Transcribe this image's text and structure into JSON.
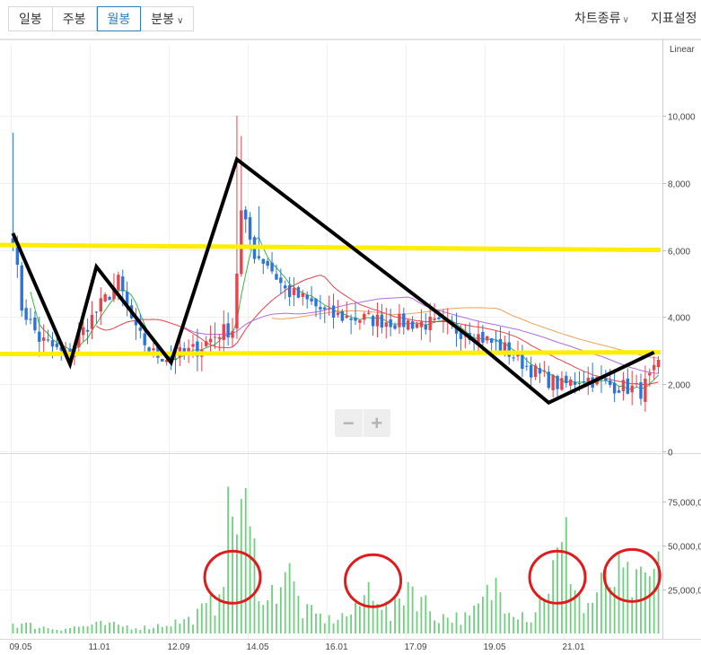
{
  "toolbar": {
    "tabs": [
      {
        "label": "일봉",
        "active": false
      },
      {
        "label": "주봉",
        "active": false
      },
      {
        "label": "월봉",
        "active": true
      },
      {
        "label": "분봉",
        "active": false,
        "dropdown": true
      }
    ],
    "chart_type_label": "차트종류",
    "indicator_label": "지표설정"
  },
  "chart_data": [
    {
      "type": "candlestick",
      "scale_label": "Linear",
      "x_ticks": [
        "09.05",
        "11.01",
        "12.09",
        "14.05",
        "16.01",
        "17.09",
        "19.05",
        "21.01"
      ],
      "y_ticks": [
        "10,000",
        "8,000",
        "6,000",
        "4,000",
        "2,000",
        "0"
      ],
      "ylim": [
        0,
        12000
      ],
      "colors": {
        "up": "#e8424c",
        "down": "#2d73d8",
        "ma5": "#3cb54a",
        "ma20": "#e8424c",
        "ma60": "#f0a35a",
        "ma120": "#b36be0"
      },
      "price_keypoints": [
        [
          0,
          6400
        ],
        [
          2,
          4300
        ],
        [
          6,
          3350
        ],
        [
          12,
          2850
        ],
        [
          20,
          4350
        ],
        [
          24,
          5050
        ],
        [
          28,
          3550
        ],
        [
          32,
          2900
        ],
        [
          36,
          2800
        ],
        [
          42,
          3050
        ],
        [
          47,
          3550
        ],
        [
          50,
          3650
        ],
        [
          52,
          7100
        ],
        [
          55,
          5900
        ],
        [
          58,
          5600
        ],
        [
          62,
          4800
        ],
        [
          68,
          4400
        ],
        [
          72,
          4050
        ],
        [
          80,
          3950
        ],
        [
          88,
          3850
        ],
        [
          95,
          3800
        ],
        [
          100,
          3650
        ],
        [
          105,
          3500
        ],
        [
          112,
          3050
        ],
        [
          115,
          2750
        ],
        [
          120,
          2250
        ],
        [
          125,
          1950
        ],
        [
          130,
          2200
        ],
        [
          135,
          2000
        ],
        [
          140,
          1900
        ],
        [
          143,
          1800
        ],
        [
          147,
          2500
        ]
      ],
      "annotations": {
        "horizontal_lines": [
          {
            "color": "#ffee00",
            "y_start": 6150,
            "y_end": 6000
          },
          {
            "color": "#ffee00",
            "y_start": 2900,
            "y_end": 2950
          }
        ],
        "zigzag": {
          "color": "#000000",
          "points": [
            [
              0,
              6500
            ],
            [
              13,
              2600
            ],
            [
              19,
              5500
            ],
            [
              36,
              2650
            ],
            [
              51,
              8700
            ],
            [
              105,
              3300
            ],
            [
              122,
              1450
            ],
            [
              146,
              2950
            ]
          ]
        }
      }
    },
    {
      "type": "bar",
      "y_ticks": [
        "75,000,0",
        "50,000,0",
        "25,000,0"
      ],
      "ylim": [
        0,
        90000000
      ],
      "color": "#6fcf7f",
      "volume_keypoints": [
        [
          0,
          7000000
        ],
        [
          10,
          3000000
        ],
        [
          20,
          6000000
        ],
        [
          30,
          4000000
        ],
        [
          40,
          9000000
        ],
        [
          46,
          20000000
        ],
        [
          48,
          55000000
        ],
        [
          50,
          80000000
        ],
        [
          52,
          88000000
        ],
        [
          54,
          60000000
        ],
        [
          58,
          20000000
        ],
        [
          62,
          45000000
        ],
        [
          66,
          15000000
        ],
        [
          72,
          9000000
        ],
        [
          78,
          14000000
        ],
        [
          82,
          35000000
        ],
        [
          86,
          10000000
        ],
        [
          90,
          35000000
        ],
        [
          96,
          12000000
        ],
        [
          104,
          10000000
        ],
        [
          110,
          32000000
        ],
        [
          114,
          18000000
        ],
        [
          118,
          10000000
        ],
        [
          122,
          35000000
        ],
        [
          126,
          58000000
        ],
        [
          130,
          15000000
        ],
        [
          134,
          30000000
        ],
        [
          138,
          38000000
        ],
        [
          142,
          30000000
        ],
        [
          147,
          40000000
        ]
      ],
      "annotations": {
        "circles": [
          {
            "color": "#e01b1b",
            "x": 50,
            "y": 32000000
          },
          {
            "color": "#e01b1b",
            "x": 82,
            "y": 30000000
          },
          {
            "color": "#e01b1b",
            "x": 124,
            "y": 32000000
          },
          {
            "color": "#e01b1b",
            "x": 141,
            "y": 33000000
          }
        ]
      }
    }
  ]
}
